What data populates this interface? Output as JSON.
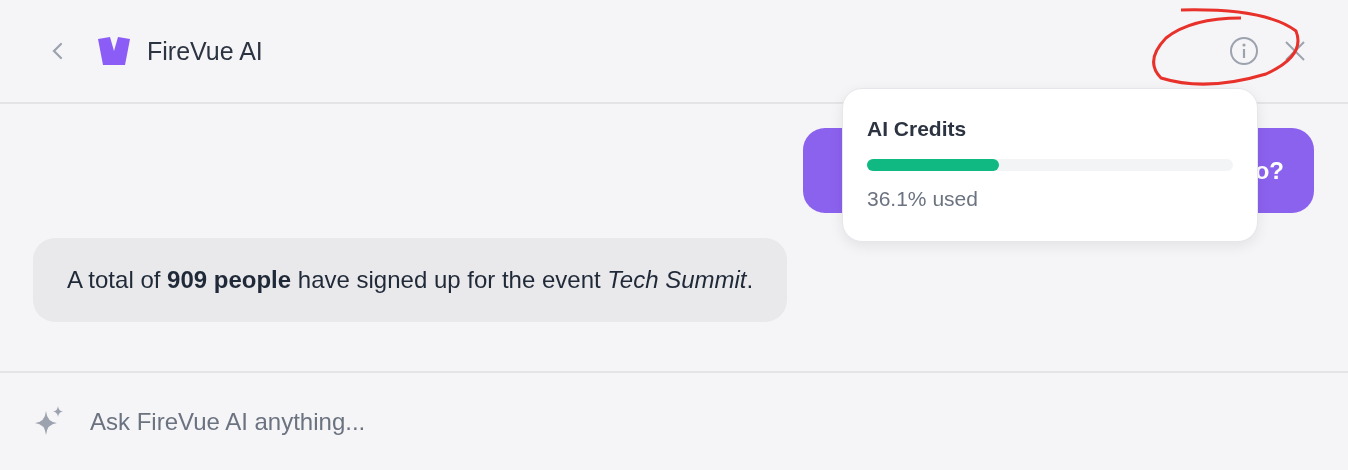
{
  "header": {
    "title": "FireVue AI"
  },
  "credits_popup": {
    "title": "AI Credits",
    "level": 0.361,
    "reading": "36.1% used"
  },
  "messages": [
    {
      "kind": "user",
      "text": "o?"
    },
    {
      "kind": "assistant",
      "text": "A total of **909 people** have signed up for the event *Tech Summit*."
    }
  ],
  "input": {
    "placeholder": "Ask FireVue AI anything..."
  }
}
